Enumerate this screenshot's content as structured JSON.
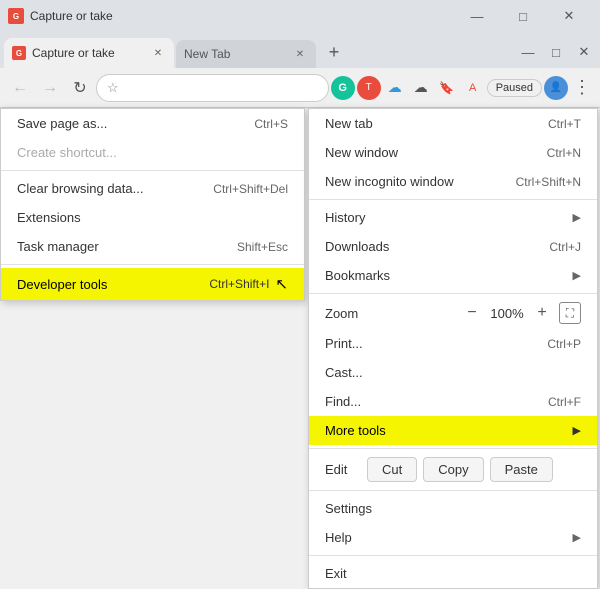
{
  "window": {
    "title": "Capture or take",
    "controls": {
      "minimize": "—",
      "maximize": "□",
      "close": "✕"
    }
  },
  "tabs": [
    {
      "id": "tab1",
      "favicon": "G",
      "label": "Capture or take",
      "active": true,
      "closeable": true
    },
    {
      "id": "tab2",
      "label": "New Tab",
      "active": false,
      "closeable": true
    }
  ],
  "new_tab_btn": "+",
  "toolbar": {
    "back_label": "←",
    "forward_label": "→",
    "refresh_label": "↻",
    "star_icon": "☆",
    "paused_label": "Paused",
    "menu_dots": "⋮"
  },
  "ext_icons": [
    {
      "id": "grammarly",
      "color": "#15c39a",
      "letter": "G"
    },
    {
      "id": "ext2",
      "color": "#e74c3c",
      "letter": "T"
    },
    {
      "id": "ext3",
      "color": "#3498db",
      "letter": "☁"
    },
    {
      "id": "ext4",
      "color": "#555",
      "letter": "☁"
    },
    {
      "id": "ext5",
      "color": "#c0392b",
      "letter": "🔖"
    },
    {
      "id": "ext6",
      "color": "#e74c3c",
      "letter": "A"
    }
  ],
  "left_menu": {
    "items": [
      {
        "id": "save-page",
        "label": "Save page as...",
        "shortcut": "Ctrl+S",
        "disabled": false
      },
      {
        "id": "create-shortcut",
        "label": "Create shortcut...",
        "shortcut": "",
        "disabled": true
      },
      {
        "id": "divider1",
        "type": "divider"
      },
      {
        "id": "clear-browsing",
        "label": "Clear browsing data...",
        "shortcut": "Ctrl+Shift+Del",
        "disabled": false
      },
      {
        "id": "extensions",
        "label": "Extensions",
        "shortcut": "",
        "disabled": false
      },
      {
        "id": "task-manager",
        "label": "Task manager",
        "shortcut": "Shift+Esc",
        "disabled": false
      },
      {
        "id": "divider2",
        "type": "divider"
      },
      {
        "id": "developer-tools",
        "label": "Developer tools",
        "shortcut": "Ctrl+Shift+I",
        "highlighted": true,
        "hasCursor": true
      }
    ]
  },
  "right_menu": {
    "items": [
      {
        "id": "new-tab",
        "label": "New tab",
        "shortcut": "Ctrl+T",
        "submenu": false
      },
      {
        "id": "new-window",
        "label": "New window",
        "shortcut": "Ctrl+N",
        "submenu": false
      },
      {
        "id": "new-incognito",
        "label": "New incognito window",
        "shortcut": "Ctrl+Shift+N",
        "submenu": false
      },
      {
        "id": "divider1",
        "type": "divider"
      },
      {
        "id": "history",
        "label": "History",
        "shortcut": "",
        "submenu": true
      },
      {
        "id": "downloads",
        "label": "Downloads",
        "shortcut": "Ctrl+J",
        "submenu": false
      },
      {
        "id": "bookmarks",
        "label": "Bookmarks",
        "shortcut": "",
        "submenu": true
      },
      {
        "id": "divider2",
        "type": "divider"
      },
      {
        "id": "zoom",
        "label": "Zoom",
        "type": "zoom",
        "minus": "-",
        "value": "100%",
        "plus": "+",
        "expand": "⛶"
      },
      {
        "id": "print",
        "label": "Print...",
        "shortcut": "Ctrl+P",
        "submenu": false
      },
      {
        "id": "cast",
        "label": "Cast...",
        "shortcut": "",
        "submenu": false
      },
      {
        "id": "find",
        "label": "Find...",
        "shortcut": "Ctrl+F",
        "submenu": false
      },
      {
        "id": "more-tools",
        "label": "More tools",
        "shortcut": "",
        "submenu": true,
        "highlighted": true
      },
      {
        "id": "divider3",
        "type": "divider"
      },
      {
        "id": "edit",
        "label": "Edit",
        "type": "edit",
        "cut": "Cut",
        "copy": "Copy",
        "paste": "Paste"
      },
      {
        "id": "divider4",
        "type": "divider"
      },
      {
        "id": "settings",
        "label": "Settings",
        "shortcut": "",
        "submenu": false
      },
      {
        "id": "help",
        "label": "Help",
        "shortcut": "",
        "submenu": true
      },
      {
        "id": "divider5",
        "type": "divider"
      },
      {
        "id": "exit",
        "label": "Exit",
        "shortcut": "",
        "submenu": false
      }
    ]
  }
}
